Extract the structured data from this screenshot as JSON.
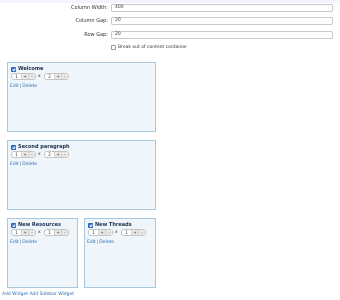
{
  "settings": {
    "column_width_label": "Column Width:",
    "column_width_value": "400",
    "column_gap_label": "Column Gap:",
    "column_gap_value": "20",
    "row_gap_label": "Row Gap:",
    "row_gap_value": "20",
    "breakout_label": "Break out of content container",
    "breakout_checked": false
  },
  "widgets": [
    {
      "title": "Welcome",
      "cols": "1",
      "rows": "2",
      "edit": "Edit",
      "delete": "Delete",
      "enabled": true
    },
    {
      "title": "Second paragraph",
      "cols": "1",
      "rows": "2",
      "edit": "Edit",
      "delete": "Delete",
      "enabled": true
    },
    {
      "title": "New Resources",
      "cols": "1",
      "rows": "1",
      "edit": "Edit",
      "delete": "Delete",
      "enabled": true
    },
    {
      "title": "New Threads",
      "cols": "1",
      "rows": "1",
      "edit": "Edit",
      "delete": "Delete",
      "enabled": true
    }
  ],
  "stepper": {
    "plus": "+",
    "minus": "-",
    "times": "x",
    "separator": "|"
  },
  "footer": {
    "add_widget": "Add Widget",
    "add_sidebar_widget": "Add Sidebar Widget"
  },
  "colors": {
    "link": "#2b6cb0",
    "widget_bg": "#eef6fb",
    "widget_border": "#a9c8de",
    "check": "#3a7bd5"
  }
}
